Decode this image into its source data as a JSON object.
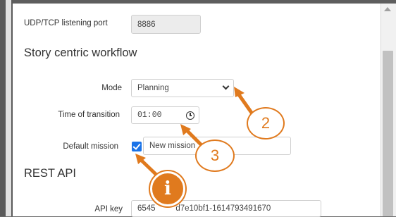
{
  "port": {
    "label": "UDP/TCP listening port",
    "value": "8886"
  },
  "story": {
    "title": "Story centric workflow",
    "mode_label": "Mode",
    "mode_value": "Planning",
    "transition_label": "Time of transition",
    "transition_value": "01:00",
    "mission_label": "Default mission",
    "mission_checked": true,
    "mission_placeholder": "New mission"
  },
  "rest": {
    "title": "REST API",
    "apikey_label": "API key",
    "apikey_value": "6545         d7e10bf1-1614793491670"
  },
  "callouts": {
    "two": "2",
    "three": "3",
    "info": "i"
  },
  "colors": {
    "accent": "#e07a1e",
    "checkbox": "#1a73e8"
  },
  "icons": [
    "chevron-down-icon",
    "clock-icon",
    "checkmark-icon",
    "scroll-up-icon"
  ]
}
